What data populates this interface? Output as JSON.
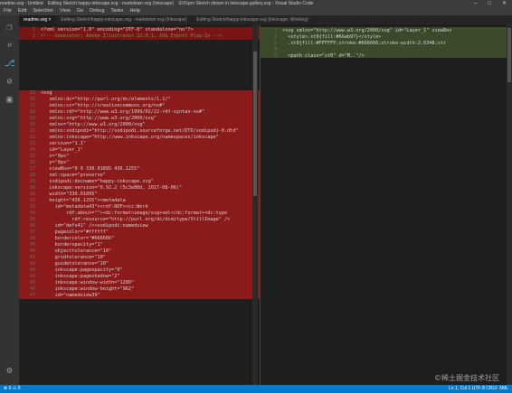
{
  "title_bar": {
    "segments": [
      "readme.svg - Untitled",
      "Editing Sketch happy-inkscape.svg - markdown svg (Inkscape)",
      "SVGpro Sketch shown in Inkscape-gallery.svg - Visual Studio Code"
    ],
    "window_controls": [
      "–",
      "□",
      "✕"
    ]
  },
  "menu": [
    "File",
    "Edit",
    "Selection",
    "View",
    "Go",
    "Debug",
    "Tasks",
    "Help"
  ],
  "activity_icons": [
    "files-icon",
    "search-icon",
    "source-control-icon",
    "debug-icon",
    "extensions-icon"
  ],
  "tabs": [
    {
      "label": "readme.svg ×",
      "active": true
    },
    {
      "label": "Editing Sketch/happy-inkscape.svg - markdown svg (Inkscape)",
      "active": false
    },
    {
      "label": "Editing Sketch/happy-inkscape.svg (Inkscape: Working)",
      "active": false
    }
  ],
  "left_pane": {
    "top_lines": [
      {
        "n": "1",
        "text": "<?xml version=\"1.0\" encoding=\"UTF-8\" standalone=\"no\"?>"
      },
      {
        "n": "2",
        "text": "<!-- Generator: Adobe Illustrator 22.0.1, SVG Export Plug-In -->"
      }
    ],
    "lines": [
      {
        "n": "15",
        "text": "<svg"
      },
      {
        "n": "16",
        "text": "   xmlns:dc=\"http://purl.org/dc/elements/1.1/\""
      },
      {
        "n": "17",
        "text": "   xmlns:cc=\"http://creativecommons.org/ns#\""
      },
      {
        "n": "18",
        "text": "   xmlns:rdf=\"http://www.w3.org/1999/02/22-rdf-syntax-ns#\""
      },
      {
        "n": "19",
        "text": "   xmlns:svg=\"http://www.w3.org/2000/svg\""
      },
      {
        "n": "20",
        "text": "   xmlns=\"http://www.w3.org/2000/svg\""
      },
      {
        "n": "21",
        "text": "   xmlns:sodipodi=\"http://sodipodi.sourceforge.net/DTD/sodipodi-0.dtd\""
      },
      {
        "n": "22",
        "text": "   xmlns:inkscape=\"http://www.inkscape.org/namespaces/inkscape\""
      },
      {
        "n": "23",
        "text": "   version=\"1.1\""
      },
      {
        "n": "24",
        "text": "   id=\"Layer_1\""
      },
      {
        "n": "25",
        "text": "   x=\"0px\""
      },
      {
        "n": "26",
        "text": "   y=\"0px\""
      },
      {
        "n": "27",
        "text": "   viewBox=\"0 0 330.01895 436.1255\""
      },
      {
        "n": "28",
        "text": "   xml:space=\"preserve\""
      },
      {
        "n": "29",
        "text": "   sodipodi:docname=\"happy-inkscape.svg\""
      },
      {
        "n": "30",
        "text": "   inkscape:version=\"0.92.2 (5c3e80d, 2017-08-06)\""
      },
      {
        "n": "31",
        "text": "   width=\"330.01895\""
      },
      {
        "n": "32",
        "text": "   height=\"436.1255\"><metadata"
      },
      {
        "n": "33",
        "text": "     id=\"metadata43\"><rdf:RDF><cc:Work"
      },
      {
        "n": "34",
        "text": "         rdf:about=\"\"><dc:format>image/svg+xml</dc:format><dc:type"
      },
      {
        "n": "35",
        "text": "           rdf:resource=\"http://purl.org/dc/dcmitype/StillImage\" />"
      },
      {
        "n": "36",
        "text": "     id=\"defs41\" /><sodipodi:namedview"
      },
      {
        "n": "37",
        "text": "     pagecolor=\"#ffffff\""
      },
      {
        "n": "38",
        "text": "     bordercolor=\"#666666\""
      },
      {
        "n": "39",
        "text": "     borderopacity=\"1\""
      },
      {
        "n": "40",
        "text": "     objecttolerance=\"10\""
      },
      {
        "n": "41",
        "text": "     gridtolerance=\"10\""
      },
      {
        "n": "42",
        "text": "     guidetolerance=\"10\""
      },
      {
        "n": "43",
        "text": "     inkscape:pageopacity=\"0\""
      },
      {
        "n": "44",
        "text": "     inkscape:pageshadow=\"2\""
      },
      {
        "n": "45",
        "text": "     inkscape:window-width=\"1280\""
      },
      {
        "n": "46",
        "text": "     inkscape:window-height=\"962\""
      },
      {
        "n": "47",
        "text": "     id=\"namedview39\""
      }
    ]
  },
  "right_pane": {
    "lines": [
      {
        "n": "1",
        "text": "<svg xmlns=\"http://www.w3.org/2000/svg\" id=\"Layer_1\" viewBox"
      },
      {
        "n": "2",
        "text": "  <style>.st0{fill:#6bab97}</style>"
      },
      {
        "n": "3",
        "text": "  .st0{fill:#FFFFFF;stroke:#666666;stroke-width:2.0348;str"
      },
      {
        "n": "4",
        "text": ""
      },
      {
        "n": "5",
        "text": "  <path class=\"st0\" d=\"M..\"/>"
      }
    ]
  },
  "status_bar": {
    "left": "⊗ 0  ⚠ 0",
    "right": "Ln 1, Col 1   UTF-8   CRLF   XML"
  },
  "watermark": "©稀土掘金技术社区",
  "colors": {
    "diff_removed": "#8b1a1a",
    "diff_added": "#3b4a2a",
    "status": "#007acc"
  }
}
